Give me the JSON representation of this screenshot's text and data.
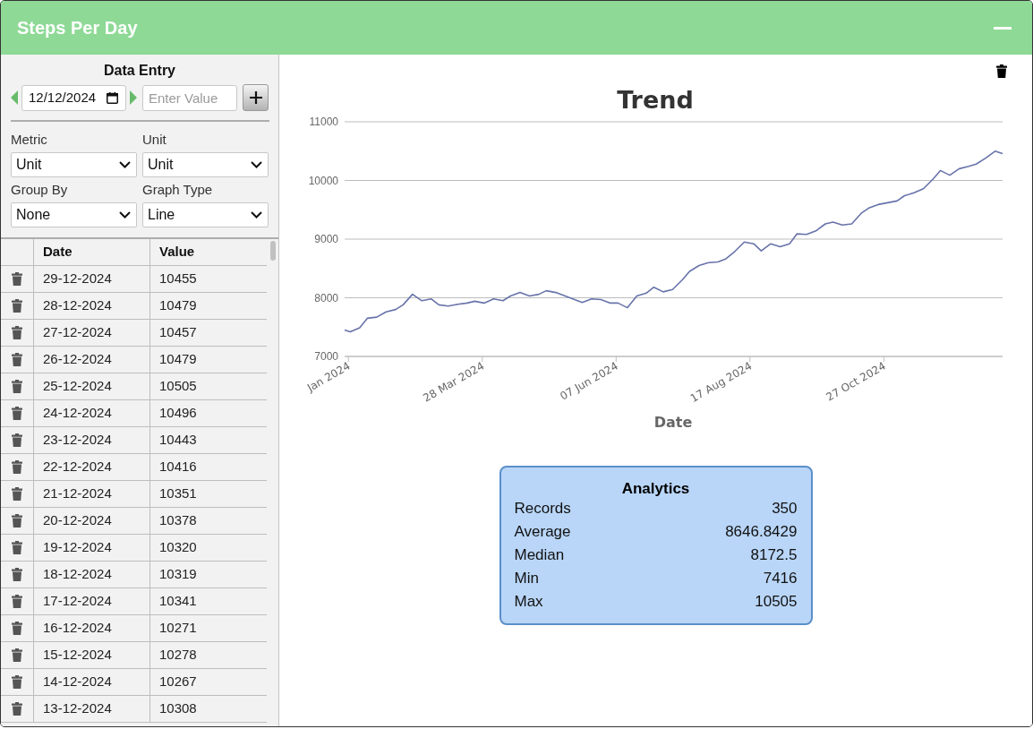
{
  "window": {
    "title": "Steps Per Day"
  },
  "data_entry": {
    "title": "Data Entry",
    "date_field": {
      "value": "12/12/2024"
    },
    "value_field": {
      "placeholder": "Enter Value"
    }
  },
  "filters": [
    {
      "label": "Metric",
      "value": "Unit"
    },
    {
      "label": "Unit",
      "value": "Unit"
    },
    {
      "label": "Group By",
      "value": "None"
    },
    {
      "label": "Graph Type",
      "value": "Line"
    }
  ],
  "table": {
    "columns": [
      "Date",
      "Value"
    ],
    "rows": [
      {
        "date": "29-12-2024",
        "value": "10455"
      },
      {
        "date": "28-12-2024",
        "value": "10479"
      },
      {
        "date": "27-12-2024",
        "value": "10457"
      },
      {
        "date": "26-12-2024",
        "value": "10479"
      },
      {
        "date": "25-12-2024",
        "value": "10505"
      },
      {
        "date": "24-12-2024",
        "value": "10496"
      },
      {
        "date": "23-12-2024",
        "value": "10443"
      },
      {
        "date": "22-12-2024",
        "value": "10416"
      },
      {
        "date": "21-12-2024",
        "value": "10351"
      },
      {
        "date": "20-12-2024",
        "value": "10378"
      },
      {
        "date": "19-12-2024",
        "value": "10320"
      },
      {
        "date": "18-12-2024",
        "value": "10319"
      },
      {
        "date": "17-12-2024",
        "value": "10341"
      },
      {
        "date": "16-12-2024",
        "value": "10271"
      },
      {
        "date": "15-12-2024",
        "value": "10278"
      },
      {
        "date": "14-12-2024",
        "value": "10267"
      },
      {
        "date": "13-12-2024",
        "value": "10308"
      }
    ]
  },
  "chart": {
    "chart_data": [
      {
        "type": "line",
        "title": "Trend",
        "xlabel": "Date",
        "grid": true,
        "color": "#6873aa",
        "xlim": [
          "2024-01-15",
          "2024-12-29"
        ],
        "ylim": [
          7000,
          11000
        ],
        "yticks": [
          7000,
          8000,
          9000,
          10000,
          11000
        ],
        "xticks": [
          {
            "value": "2024-01-17",
            "label": "Jan 2024"
          },
          {
            "value": "2024-03-28",
            "label": "28 Mar 2024"
          },
          {
            "value": "2024-06-07",
            "label": "07 Jun 2024"
          },
          {
            "value": "2024-08-17",
            "label": "17 Aug 2024"
          },
          {
            "value": "2024-10-27",
            "label": "27 Oct 2024"
          }
        ],
        "x": [
          "2024-01-15",
          "2024-01-18",
          "2024-01-23",
          "2024-01-27",
          "2024-02-01",
          "2024-02-06",
          "2024-02-11",
          "2024-02-15",
          "2024-02-20",
          "2024-02-25",
          "2024-03-01",
          "2024-03-05",
          "2024-03-10",
          "2024-03-15",
          "2024-03-20",
          "2024-03-24",
          "2024-03-29",
          "2024-04-03",
          "2024-04-08",
          "2024-04-12",
          "2024-04-17",
          "2024-04-22",
          "2024-04-27",
          "2024-05-01",
          "2024-05-06",
          "2024-05-11",
          "2024-05-16",
          "2024-05-20",
          "2024-05-25",
          "2024-05-30",
          "2024-06-04",
          "2024-06-08",
          "2024-06-13",
          "2024-06-18",
          "2024-06-23",
          "2024-06-27",
          "2024-07-02",
          "2024-07-07",
          "2024-07-12",
          "2024-07-16",
          "2024-07-21",
          "2024-07-26",
          "2024-07-31",
          "2024-08-04",
          "2024-08-09",
          "2024-08-14",
          "2024-08-19",
          "2024-08-23",
          "2024-08-28",
          "2024-09-02",
          "2024-09-07",
          "2024-09-11",
          "2024-09-16",
          "2024-09-21",
          "2024-09-26",
          "2024-09-30",
          "2024-10-05",
          "2024-10-10",
          "2024-10-15",
          "2024-10-19",
          "2024-10-24",
          "2024-10-29",
          "2024-11-03",
          "2024-11-07",
          "2024-11-12",
          "2024-11-17",
          "2024-11-22",
          "2024-11-26",
          "2024-12-01",
          "2024-12-06",
          "2024-12-11",
          "2024-12-15",
          "2024-12-20",
          "2024-12-25",
          "2024-12-29"
        ],
        "values": [
          7450,
          7420,
          7490,
          7650,
          7670,
          7760,
          7800,
          7880,
          8060,
          7950,
          7980,
          7880,
          7860,
          7890,
          7910,
          7940,
          7910,
          7980,
          7950,
          8030,
          8090,
          8030,
          8060,
          8120,
          8090,
          8030,
          7970,
          7920,
          7980,
          7970,
          7910,
          7910,
          7830,
          8030,
          8080,
          8180,
          8100,
          8140,
          8300,
          8450,
          8550,
          8600,
          8610,
          8660,
          8790,
          8950,
          8920,
          8800,
          8920,
          8870,
          8920,
          9090,
          9080,
          9140,
          9260,
          9290,
          9240,
          9260,
          9440,
          9530,
          9590,
          9620,
          9650,
          9740,
          9790,
          9860,
          10020,
          10170,
          10090,
          10200,
          10240,
          10280,
          10380,
          10500,
          10460
        ]
      }
    ]
  },
  "analytics": {
    "title": "Analytics",
    "stats": [
      {
        "label": "Records",
        "value": "350"
      },
      {
        "label": "Average",
        "value": "8646.8429"
      },
      {
        "label": "Median",
        "value": "8172.5"
      },
      {
        "label": "Min",
        "value": "7416"
      },
      {
        "label": "Max",
        "value": "10505"
      }
    ]
  }
}
